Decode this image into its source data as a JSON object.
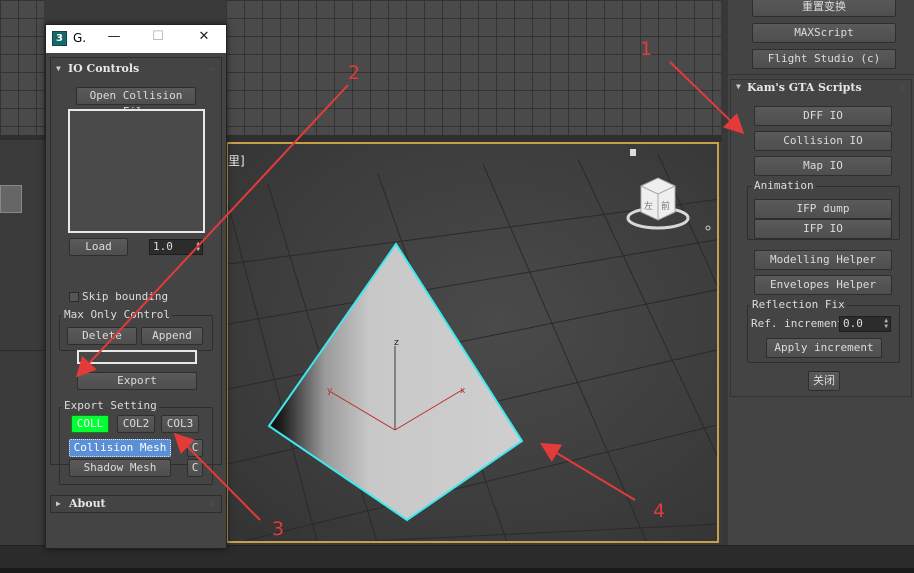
{
  "viewport": {
    "main_label": "里]",
    "axes": {
      "x": "x",
      "y": "y",
      "z": "z"
    },
    "viewcube_face_front": "前",
    "viewcube_face_left": "左"
  },
  "right_panel": {
    "top_buttons": [
      "重置变换",
      "MAXScript",
      "Flight Studio (c)"
    ],
    "rollout_title": "Kam's GTA Scripts",
    "buttons": [
      "DFF IO",
      "Collision IO",
      "Map IO"
    ],
    "animation_group": "Animation",
    "animation_buttons": [
      "IFP dump",
      "IFP IO"
    ],
    "helper_buttons": [
      "Modelling Helper",
      "Envelopes Helper"
    ],
    "reflection_group": "Reflection Fix",
    "ref_increment_label": "Ref. increment",
    "ref_increment_value": "0.0",
    "apply_button": "Apply increment",
    "close_button": "关闭"
  },
  "float_window": {
    "app_icon": "3",
    "title": "G.",
    "minimize": "—",
    "maximize": "☐",
    "close": "✕",
    "io_rollout_title": "IO Controls",
    "open_collision_button": "Open Collision File",
    "load_button": "Load",
    "version_value": "1.0",
    "skip_bounding_label": "Skip bounding",
    "max_only_group": "Max Only Control",
    "delete_button": "Delete",
    "append_button": "Append",
    "export_button": "Export",
    "export_setting_group": "Export Setting",
    "col_buttons": [
      "COLL",
      "COL2",
      "COL3"
    ],
    "collision_mesh_button": "Collision Mesh",
    "shadow_mesh_button": "Shadow Mesh",
    "c_button": "C",
    "about_rollout_title": "About",
    "expanded_glyph": "▼",
    "collapsed_glyph": "▶"
  },
  "annotations": [
    "1",
    "2",
    "3",
    "4"
  ],
  "colors": {
    "accent_green": "#00ff33",
    "selected_blue": "#5b8fd6",
    "annotation_red": "#e33a3a",
    "selection_cyan": "#3ee8f0",
    "viewport_border": "#c7a04a"
  }
}
